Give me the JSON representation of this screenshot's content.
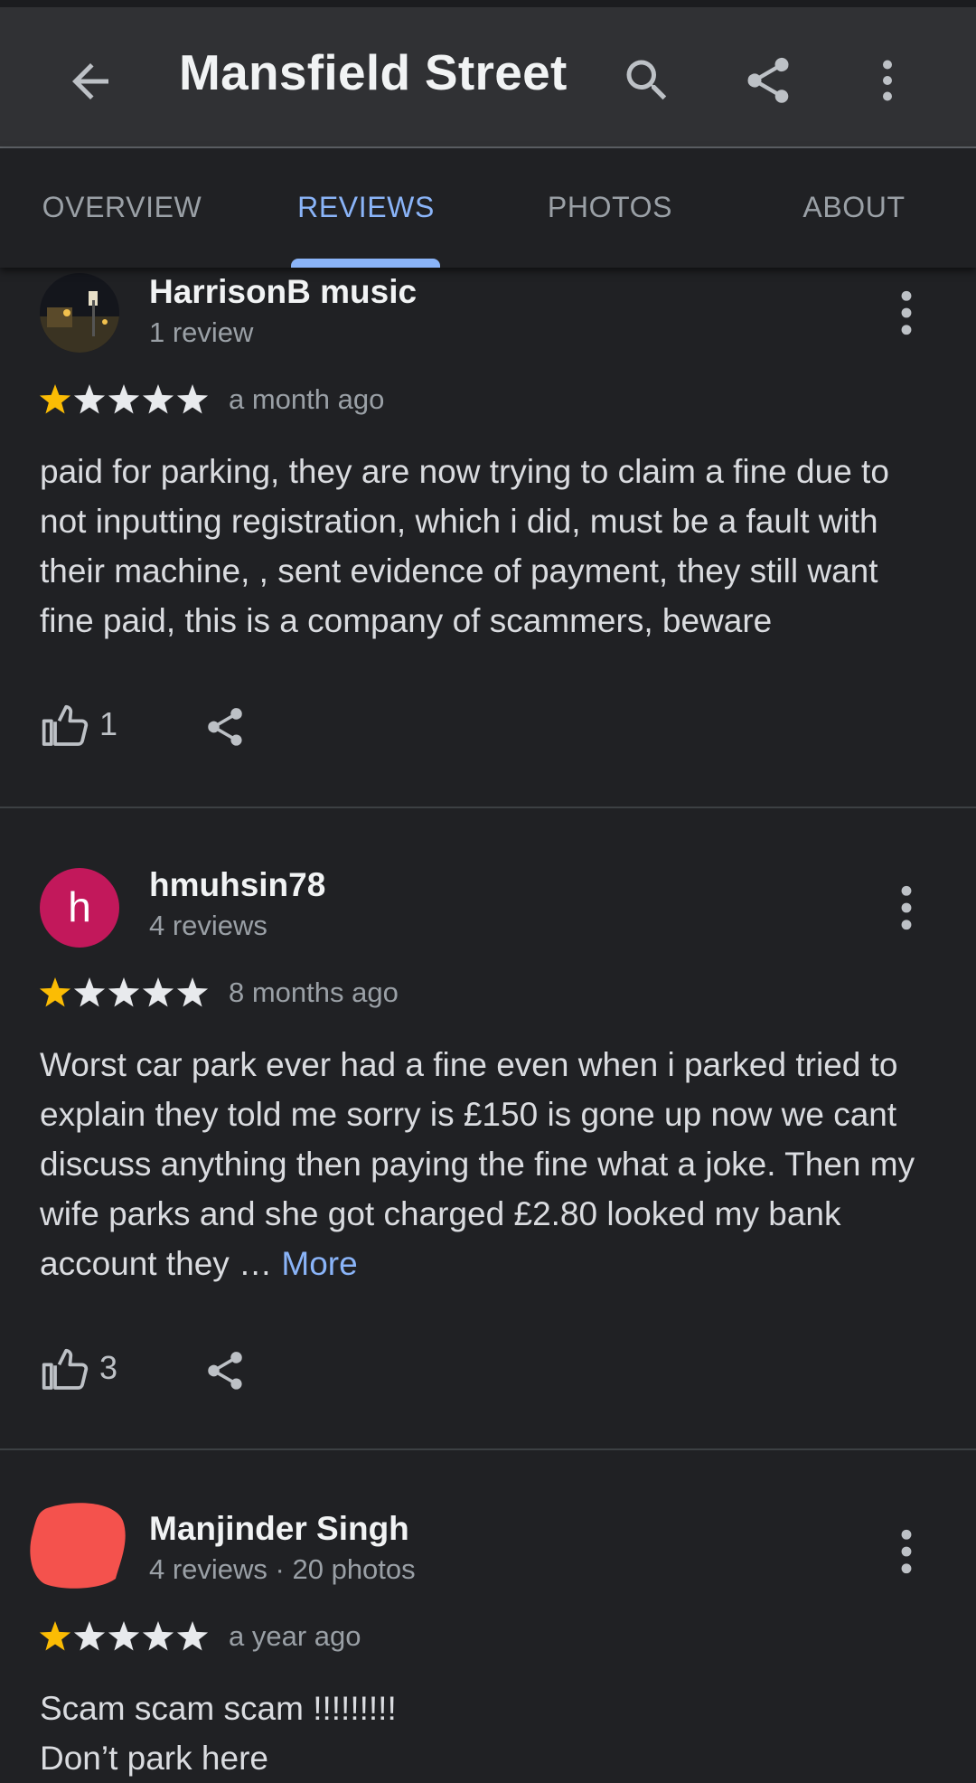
{
  "appbar": {
    "title": "Mansfield Street",
    "icons": [
      "back-arrow-icon",
      "search-icon",
      "share-icon",
      "more-vert-icon"
    ]
  },
  "tabs": [
    {
      "label": "OVERVIEW",
      "active": false
    },
    {
      "label": "REVIEWS",
      "active": true
    },
    {
      "label": "PHOTOS",
      "active": false
    },
    {
      "label": "ABOUT",
      "active": false
    }
  ],
  "colors": {
    "background": "#202124",
    "accent": "#8ab4f8",
    "star_filled": "#fbbc04",
    "star_empty": "#e8eaed",
    "avatar_h": "#c2185b"
  },
  "reviews": [
    {
      "author": "HarrisonB music",
      "meta": "1 review",
      "rating": 1,
      "when": "a month ago",
      "text": "paid for parking, they are now trying to claim a fine due to not inputting registration, which i did, must be a fault with their machine, , sent evidence of payment, they still want fine paid, this is a company of scammers, beware",
      "likes": "1"
    },
    {
      "author": "hmuhsin78",
      "avatar_letter": "h",
      "meta": "4 reviews",
      "rating": 1,
      "when": "8 months ago",
      "text": "Worst car park ever had a fine even when i parked tried to explain they told me sorry is £150 is gone up now we cant discuss anything then paying the fine what a joke. Then my wife parks and she got charged £2.80 looked my bank account they …",
      "more_label": "More",
      "likes": "3"
    },
    {
      "author": "Manjinder Singh",
      "meta": "4 reviews · 20 photos",
      "rating": 1,
      "when": "a year ago",
      "text_line1": "Scam scam scam !!!!!!!!!",
      "text_line2": "Don’t park here"
    }
  ]
}
